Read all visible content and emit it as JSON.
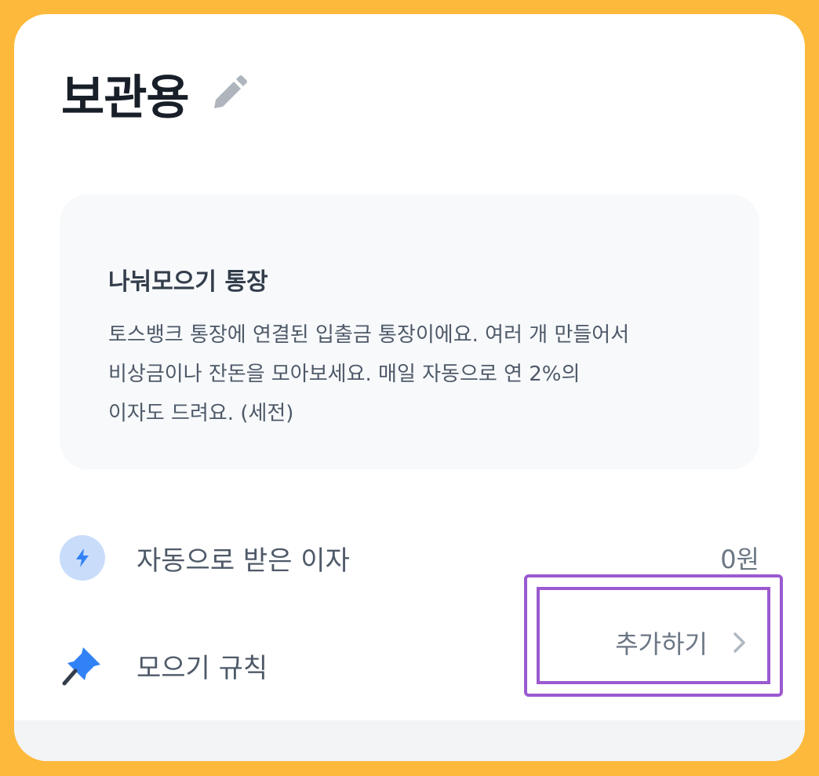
{
  "header": {
    "title": "보관용",
    "edit_icon": "pencil-icon"
  },
  "info": {
    "title": "나눠모으기 통장",
    "description": "토스뱅크 통장에 연결된 입출금 통장이에요. 여러 개 만들어서\n비상금이나 잔돈을 모아보세요. 매일 자동으로 연 2%의\n이자도 드려요. (세전)"
  },
  "interest_row": {
    "icon": "lightning-icon",
    "label": "자동으로 받은 이자",
    "value": "0원"
  },
  "rule_row": {
    "icon": "pushpin-icon",
    "label": "모으기 규칙",
    "action_label": "추가하기",
    "action_icon": "chevron-right-icon"
  },
  "colors": {
    "background": "#FDB93B",
    "card": "#FFFFFF",
    "accent_blue": "#3182F6",
    "highlight": "#9B59D0"
  }
}
